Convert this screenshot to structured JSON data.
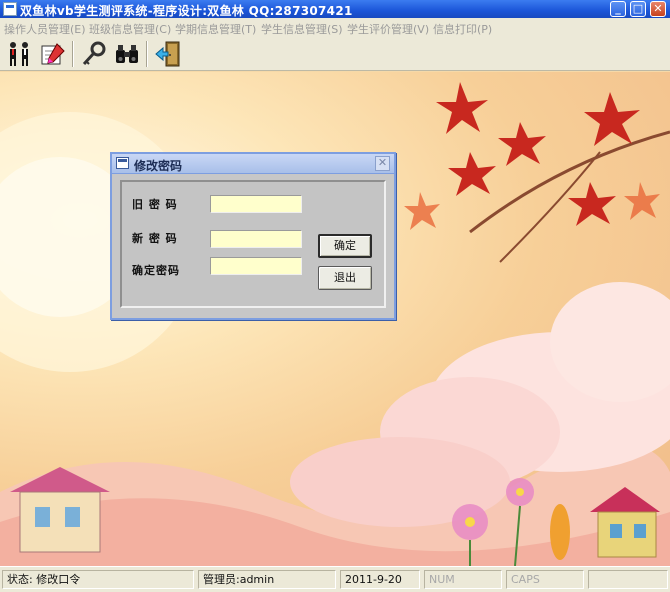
{
  "window": {
    "title": "双鱼林vb学生测评系统-程序设计:双鱼林 QQ:287307421",
    "minimize_icon": "minimize-icon",
    "maximize_icon": "maximize-icon",
    "close_icon": "close-icon"
  },
  "menu": {
    "items": [
      {
        "label": "操作人员管理(E)"
      },
      {
        "label": "班级信息管理(C)"
      },
      {
        "label": "学期信息管理(T)"
      },
      {
        "label": "学生信息管理(S)"
      },
      {
        "label": "学生评价管理(V)"
      },
      {
        "label": "信息打印(P)"
      }
    ]
  },
  "toolbar": {
    "buttons": [
      {
        "icon": "users-icon"
      },
      {
        "icon": "edit-document-icon"
      },
      {
        "icon": "key-icon"
      },
      {
        "icon": "binoculars-icon"
      },
      {
        "icon": "exit-door-icon"
      }
    ]
  },
  "dialog": {
    "title": "修改密码",
    "old_password_label": "旧 密 码",
    "new_password_label": "新 密 码",
    "confirm_password_label": "确定密码",
    "old_password_value": "",
    "new_password_value": "",
    "confirm_password_value": "",
    "ok_label": "确定",
    "exit_label": "退出"
  },
  "statusbar": {
    "status": "状态:  修改口令",
    "admin": "管理员:admin",
    "date": "2011-9-20",
    "num": "NUM",
    "caps": "CAPS"
  },
  "colors": {
    "titlebar": "#1b55d8",
    "input_background": "#ffffcc",
    "dialog_border": "#7d9ee0"
  }
}
